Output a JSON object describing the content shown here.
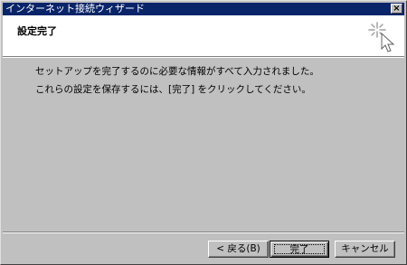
{
  "window": {
    "title": "インターネット接続ウィザード",
    "close_label": "×"
  },
  "header": {
    "title": "設定完了",
    "icon": "wizard-sparkle-cursor-icon"
  },
  "body": {
    "line1": "セットアップを完了するのに必要な情報がすべて入力されました。",
    "line2": "これらの設定を保存するには、[完了] をクリックしてください。"
  },
  "buttons": {
    "back": "< 戻る(B)",
    "finish": "完了",
    "cancel": "キャンセル"
  }
}
